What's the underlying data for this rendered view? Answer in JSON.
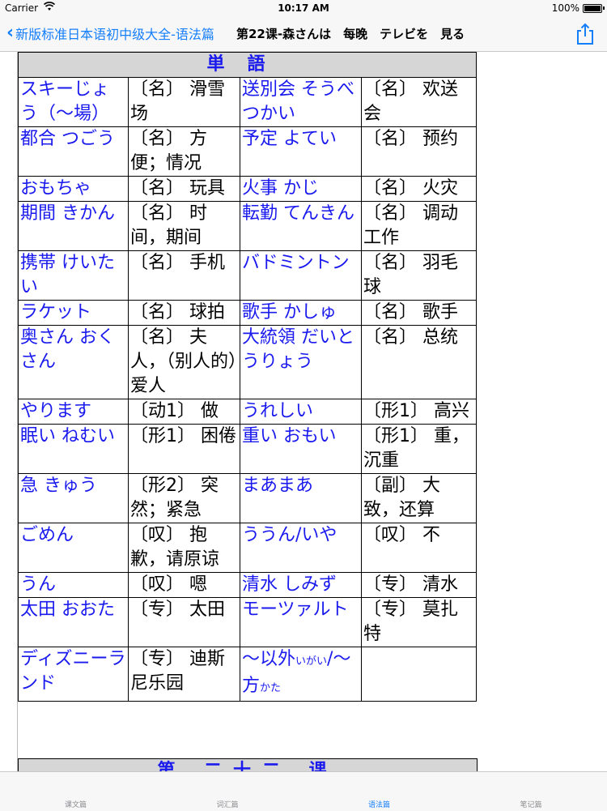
{
  "status_bar": {
    "carrier": "Carrier",
    "time": "10:17 AM",
    "battery": "100%"
  },
  "nav": {
    "back_label": "新版标准日本语初中级大全-语法篇",
    "title": "第22课-森さんは　每晚　テレビを　見る"
  },
  "table": {
    "header": "単語",
    "rows": [
      [
        {
          "w": "スキーじょう（～場）"
        },
        {
          "d": "〔名〕 滑雪场"
        },
        {
          "w": "送別会 そうべつかい"
        },
        {
          "d": "〔名〕 欢送会"
        }
      ],
      [
        {
          "w": "都合 つごう"
        },
        {
          "d": "〔名〕 方便；情况"
        },
        {
          "w": "予定 よてい"
        },
        {
          "d": "〔名〕 预约"
        }
      ],
      [
        {
          "w": "おもちゃ"
        },
        {
          "d": "〔名〕 玩具"
        },
        {
          "w": "火事 かじ"
        },
        {
          "d": "〔名〕 火灾"
        }
      ],
      [
        {
          "w": "期間 きかん"
        },
        {
          "d": "〔名〕 时间，期间"
        },
        {
          "w": "転勤 てんきん"
        },
        {
          "d": "〔名〕 调动工作"
        }
      ],
      [
        {
          "w": "携帯 けいたい"
        },
        {
          "d": "〔名〕 手机"
        },
        {
          "w": "バドミントン"
        },
        {
          "d": "〔名〕 羽毛球"
        }
      ],
      [
        {
          "w": "ラケット"
        },
        {
          "d": "〔名〕 球拍"
        },
        {
          "w": "歌手 かしゅ"
        },
        {
          "d": "〔名〕 歌手"
        }
      ],
      [
        {
          "w": "奥さん おくさん"
        },
        {
          "d": "〔名〕 夫人，（别人的）爱人"
        },
        {
          "w": "大統領 だいとうりょう"
        },
        {
          "d": "〔名〕 总统"
        }
      ],
      [
        {
          "w": "やります"
        },
        {
          "d": "〔动1〕 做"
        },
        {
          "w": "うれしい"
        },
        {
          "d": "〔形1〕 高兴"
        }
      ],
      [
        {
          "w": "眠い ねむい"
        },
        {
          "d": "〔形1〕 困倦"
        },
        {
          "w": "重い おもい"
        },
        {
          "d": "〔形1〕 重，沉重"
        }
      ],
      [
        {
          "w": "急 きゅう"
        },
        {
          "d": "〔形2〕 突然；紧急"
        },
        {
          "w": "まあまあ"
        },
        {
          "d": "〔副〕 大致，还算"
        }
      ],
      [
        {
          "w": "ごめん"
        },
        {
          "d": "〔叹〕 抱歉，请原谅"
        },
        {
          "w": "ううん/いや"
        },
        {
          "d": "〔叹〕 不"
        }
      ],
      [
        {
          "w": "うん"
        },
        {
          "d": "〔叹〕 嗯"
        },
        {
          "w": "清水 しみず"
        },
        {
          "d": "〔专〕 清水"
        }
      ],
      [
        {
          "w": "太田 おおた"
        },
        {
          "d": "〔专〕 太田"
        },
        {
          "w": "モーツァルト"
        },
        {
          "d": "〔专〕 莫扎特"
        }
      ],
      [
        {
          "w": "ディズニーランド"
        },
        {
          "d": "〔专〕 迪斯尼乐园"
        },
        {
          "w": "～以外",
          "r": "いがい",
          "w2": "/～方",
          "r2": "かた"
        },
        {
          "d": ""
        }
      ]
    ],
    "bottom_header": "第 二十二 课"
  },
  "tabs": [
    {
      "label": "课文篇",
      "active": false
    },
    {
      "label": "词汇篇",
      "active": false
    },
    {
      "label": "语法篇",
      "active": true
    },
    {
      "label": "笔记篇",
      "active": false
    }
  ],
  "colors": {
    "accent": "#147efb",
    "word": "#1a1aee",
    "header_bg": "#d6d6d6"
  },
  "icons": [
    "back-chevron-icon",
    "share-icon",
    "wifi-icon",
    "battery-icon"
  ]
}
